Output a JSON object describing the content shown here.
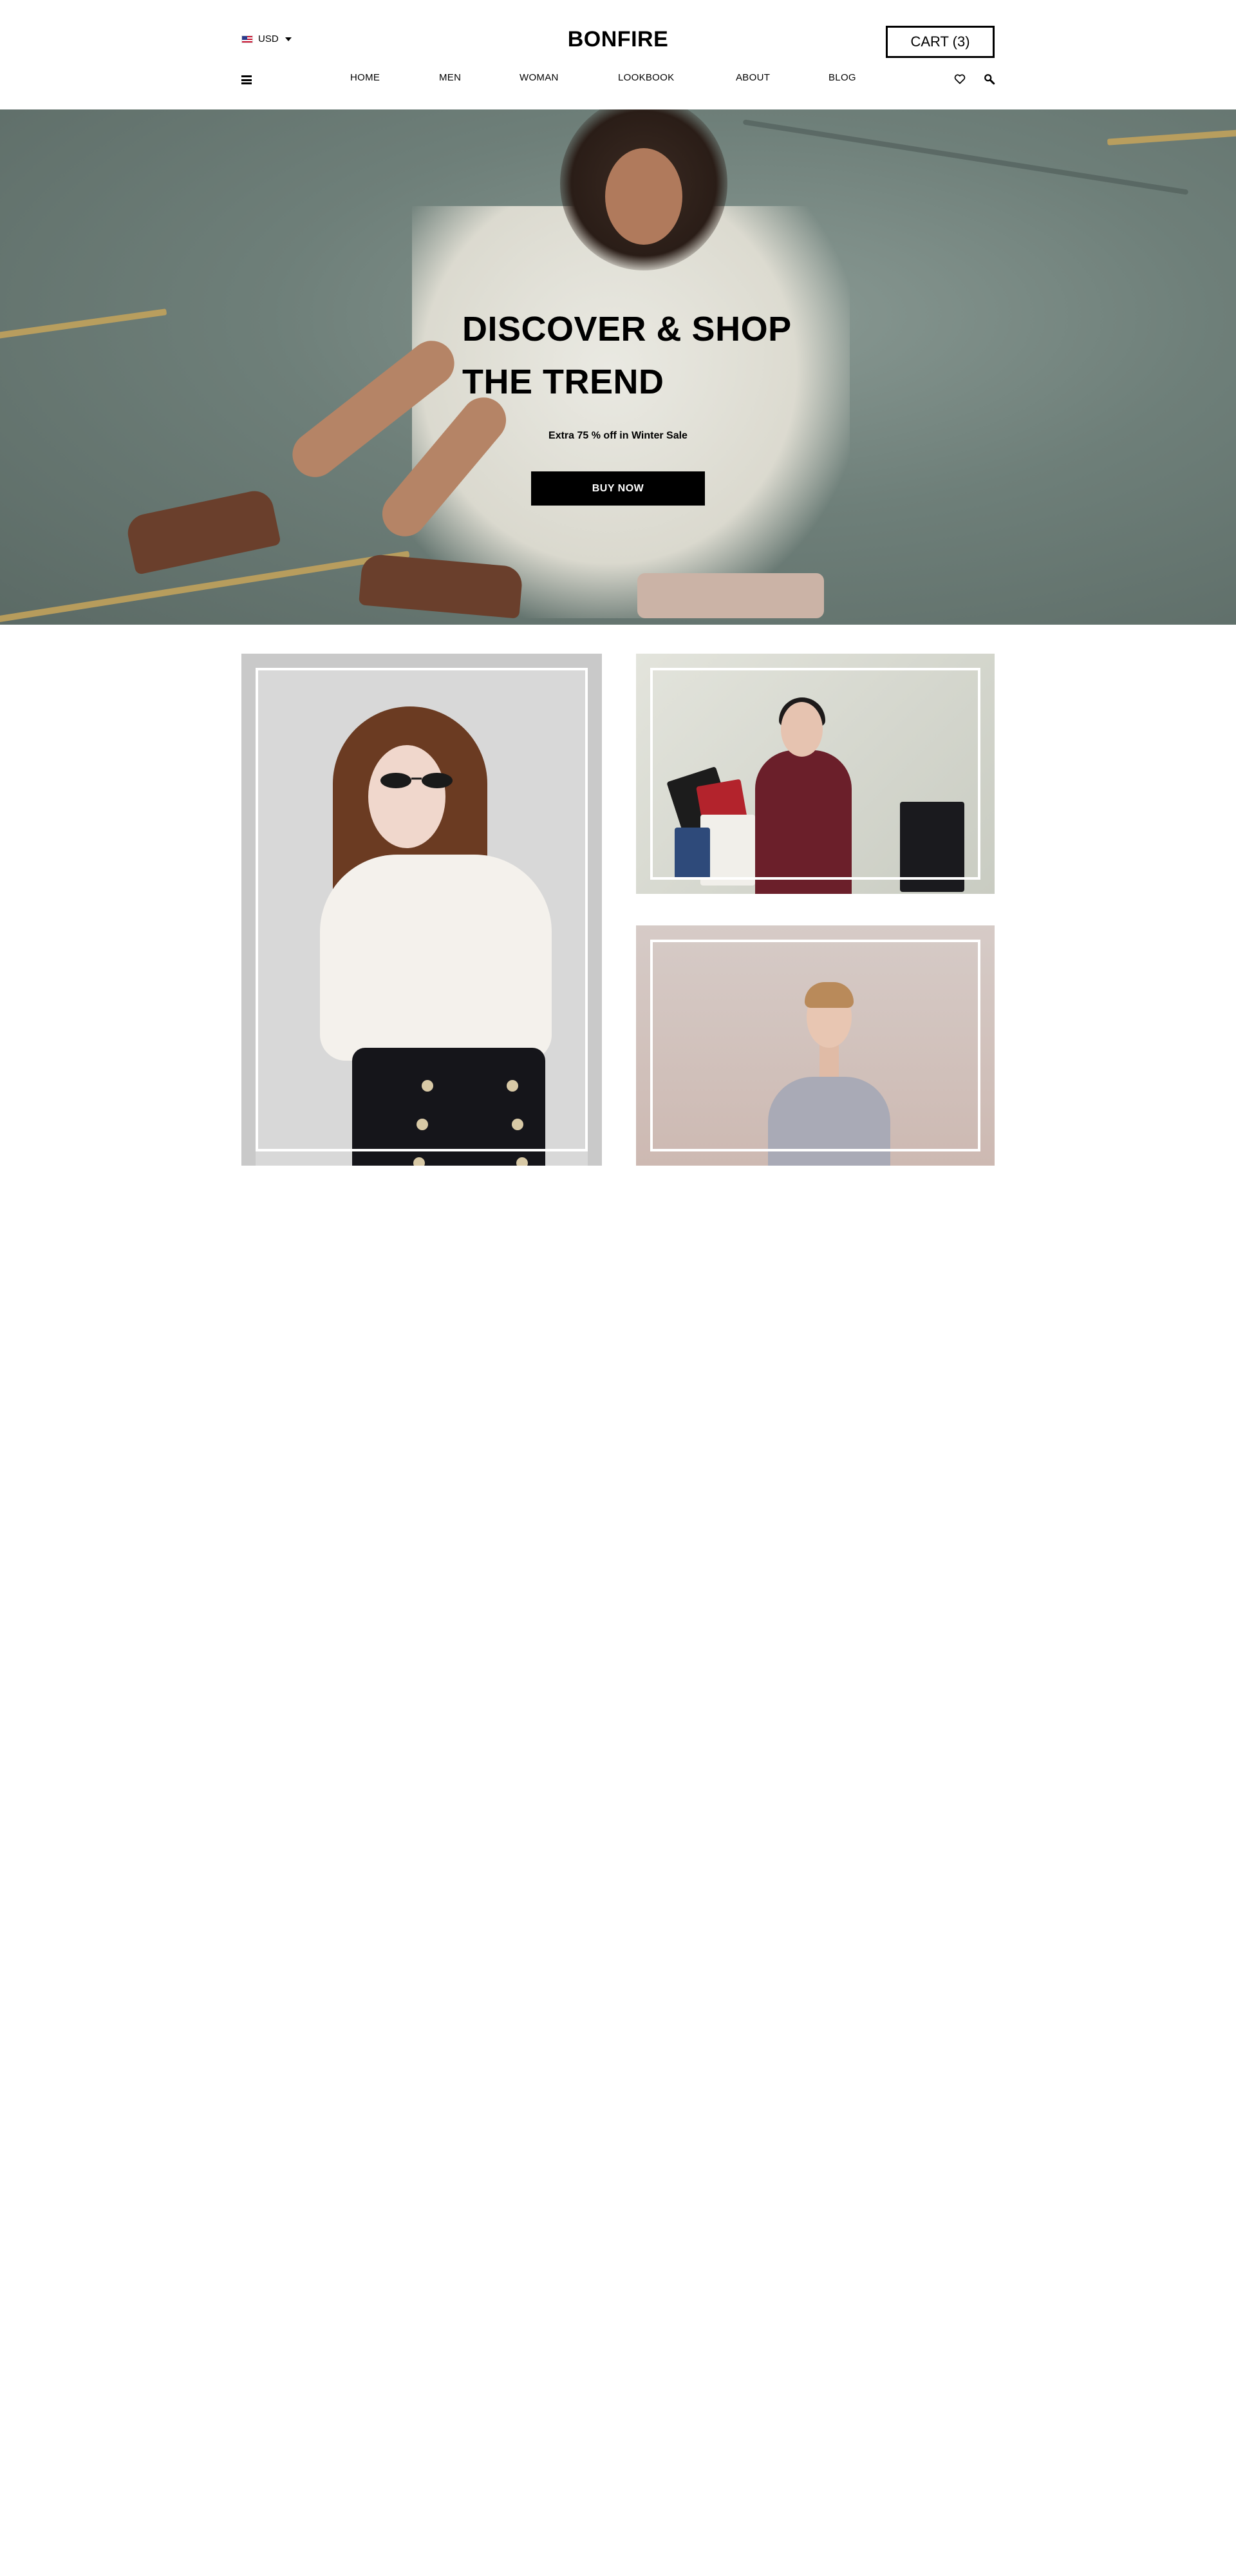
{
  "header": {
    "currency_label": "USD",
    "logo": "BONFIRE",
    "cart_label": "CART (3)",
    "nav": [
      {
        "label": "HOME"
      },
      {
        "label": "MEN"
      },
      {
        "label": "WOMAN"
      },
      {
        "label": "LOOKBOOK"
      },
      {
        "label": "ABOUT"
      },
      {
        "label": "BLOG"
      }
    ]
  },
  "hero": {
    "title_line1": "DISCOVER & SHOP",
    "title_line2": "THE TREND",
    "subtitle": "Extra 75 % off in Winter Sale",
    "cta_label": "BUY NOW"
  },
  "categories": [
    {
      "id": "woman",
      "image": "woman with sunglasses, white blouse and black skirt"
    },
    {
      "id": "shopping",
      "image": "woman in burgundy coat holding shopping bags"
    },
    {
      "id": "man",
      "image": "man in grey sweatshirt"
    }
  ],
  "colors": {
    "accent": "#000000",
    "background": "#ffffff",
    "button_text": "#ffffff"
  },
  "icons": {
    "menu": "hamburger-icon",
    "wishlist": "heart-icon",
    "search": "search-icon",
    "currency_dropdown": "chevron-down-icon",
    "flag": "us-flag-icon"
  }
}
